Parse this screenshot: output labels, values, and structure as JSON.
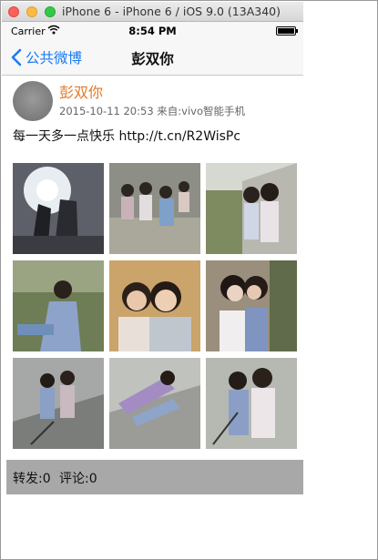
{
  "window": {
    "title": "iPhone 6 - iPhone 6 / iOS 9.0 (13A340)"
  },
  "status_bar": {
    "carrier": "Carrier",
    "time": "8:54 PM",
    "battery_level": 1.0,
    "icons": [
      "wifi-icon",
      "battery-icon"
    ]
  },
  "nav_bar": {
    "back_label": "公共微博",
    "title": "彭双你",
    "back_icon": "chevron-left-icon",
    "accent_color": "#1a7cf6"
  },
  "post": {
    "username": "彭双你",
    "username_color": "#e27a2a",
    "meta": "2015-10-11 20:53 来自:vivo智能手机",
    "text": "每一天多一点快乐 http://t.cn/R2WisPc",
    "photo_count": 9
  },
  "actions": {
    "repost": "转发:0",
    "comment": "评论:0",
    "bar_color": "#a8a8a8"
  }
}
